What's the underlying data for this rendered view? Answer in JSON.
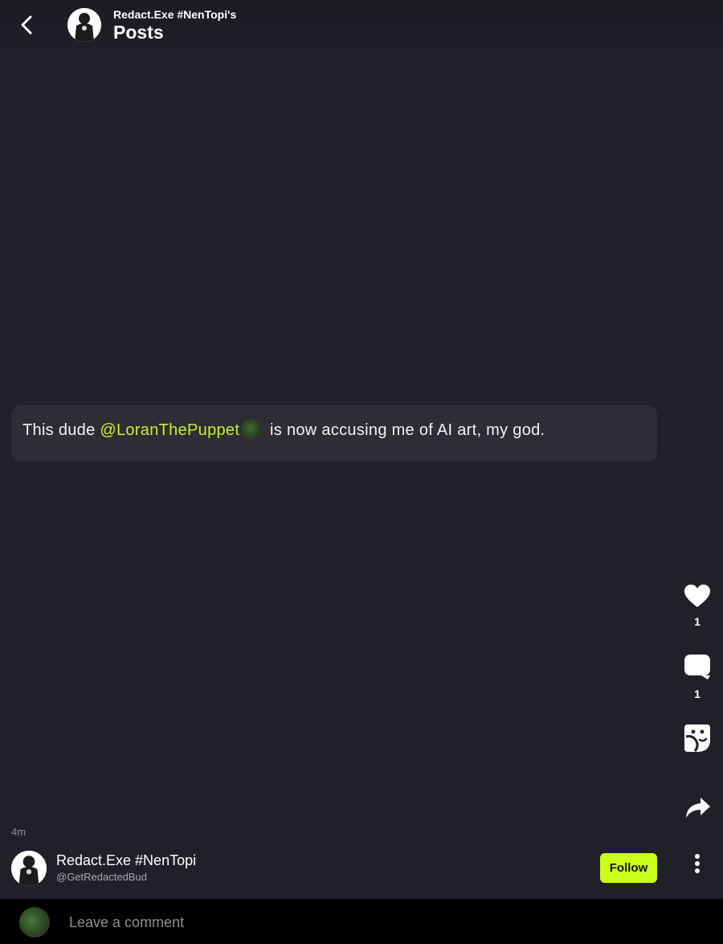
{
  "header": {
    "subtitle": "Redact.Exe #NenTopi's",
    "title": "Posts"
  },
  "post": {
    "text_before": "This dude ",
    "mention": "@LoranThePuppet",
    "text_after": " is now accusing me of AI art, my god.",
    "time": "4m"
  },
  "actions": {
    "like_count": "1",
    "comment_count": "1"
  },
  "author": {
    "name": "Redact.Exe #NenTopi",
    "handle": "@GetRedactedBud",
    "follow_label": "Follow"
  },
  "comment": {
    "placeholder": "Leave a comment"
  },
  "colors": {
    "background": "#212029",
    "accent": "#ccff1a",
    "mention": "#c6f02c",
    "bubble": "#2e2d36"
  },
  "icons": [
    "back-arrow-icon",
    "heart-icon",
    "comment-icon",
    "sticker-icon",
    "share-icon",
    "more-vertical-icon"
  ]
}
